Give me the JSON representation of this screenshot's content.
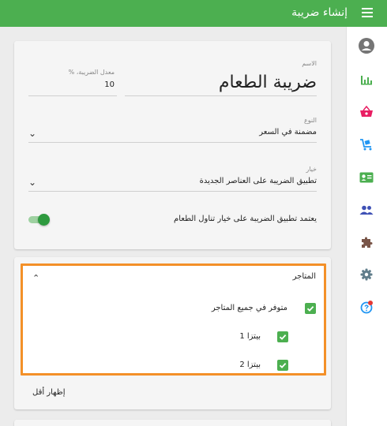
{
  "header": {
    "title": "إنشاء ضريبة"
  },
  "sidebar": {
    "items": [
      {
        "name": "account",
        "icon": "account-icon"
      },
      {
        "name": "reports",
        "icon": "chart-bar-icon"
      },
      {
        "name": "sales",
        "icon": "basket-icon"
      },
      {
        "name": "inventory",
        "icon": "cart-icon"
      },
      {
        "name": "employees",
        "icon": "id-card-icon"
      },
      {
        "name": "customers",
        "icon": "people-icon"
      },
      {
        "name": "apps",
        "icon": "puzzle-icon"
      },
      {
        "name": "settings",
        "icon": "gear-icon"
      },
      {
        "name": "help",
        "icon": "help-icon"
      }
    ]
  },
  "form": {
    "name_label": "الاسم",
    "name_value": "ضريبة الطعام",
    "rate_label": "معدل الضريبة، %",
    "rate_value": "10",
    "type_label": "النوع",
    "type_value": "مضمنة في السعر",
    "option_label": "خيار",
    "option_value": "تطبيق الضريبة على العناصر الجديدة",
    "dining_toggle_label": "يعتمد تطبيق الضريبة على خيار تناول الطعام",
    "dining_toggle_on": true
  },
  "stores": {
    "title": "المتاجر",
    "all_stores_label": "متوفر في جميع المتاجر",
    "all_stores_checked": true,
    "list": [
      {
        "label": "بيتزا 1",
        "checked": true
      },
      {
        "label": "بيتزا 2",
        "checked": true
      }
    ],
    "show_less": "إظهار أقل"
  },
  "colors": {
    "primary": "#4caf50",
    "highlight": "#f39028"
  }
}
